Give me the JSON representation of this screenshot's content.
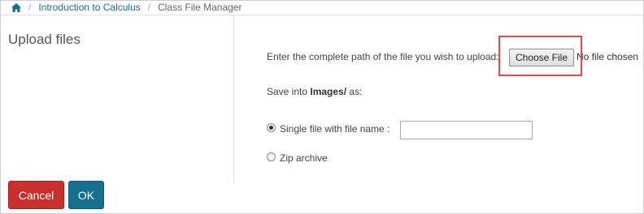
{
  "breadcrumb": {
    "home_icon": "home-icon",
    "separator": "/",
    "course": "Introduction to Calculus",
    "current": "Class File Manager"
  },
  "left": {
    "title": "Upload files"
  },
  "form": {
    "path_label": "Enter the complete path of the file you wish to upload:",
    "choose_button": "Choose File",
    "no_file": "No file chosen",
    "save_prefix": "Save into ",
    "save_folder": "Images/",
    "save_suffix": " as:",
    "option_single": "Single file with file name :",
    "option_zip": "Zip archive",
    "filename_value": "",
    "selected_option": "single"
  },
  "actions": {
    "cancel": "Cancel",
    "ok": "OK"
  },
  "colors": {
    "link": "#1b6e8a",
    "cancel_bg": "#c9302c",
    "ok_bg": "#156f8f",
    "highlight": "#e5474f"
  }
}
